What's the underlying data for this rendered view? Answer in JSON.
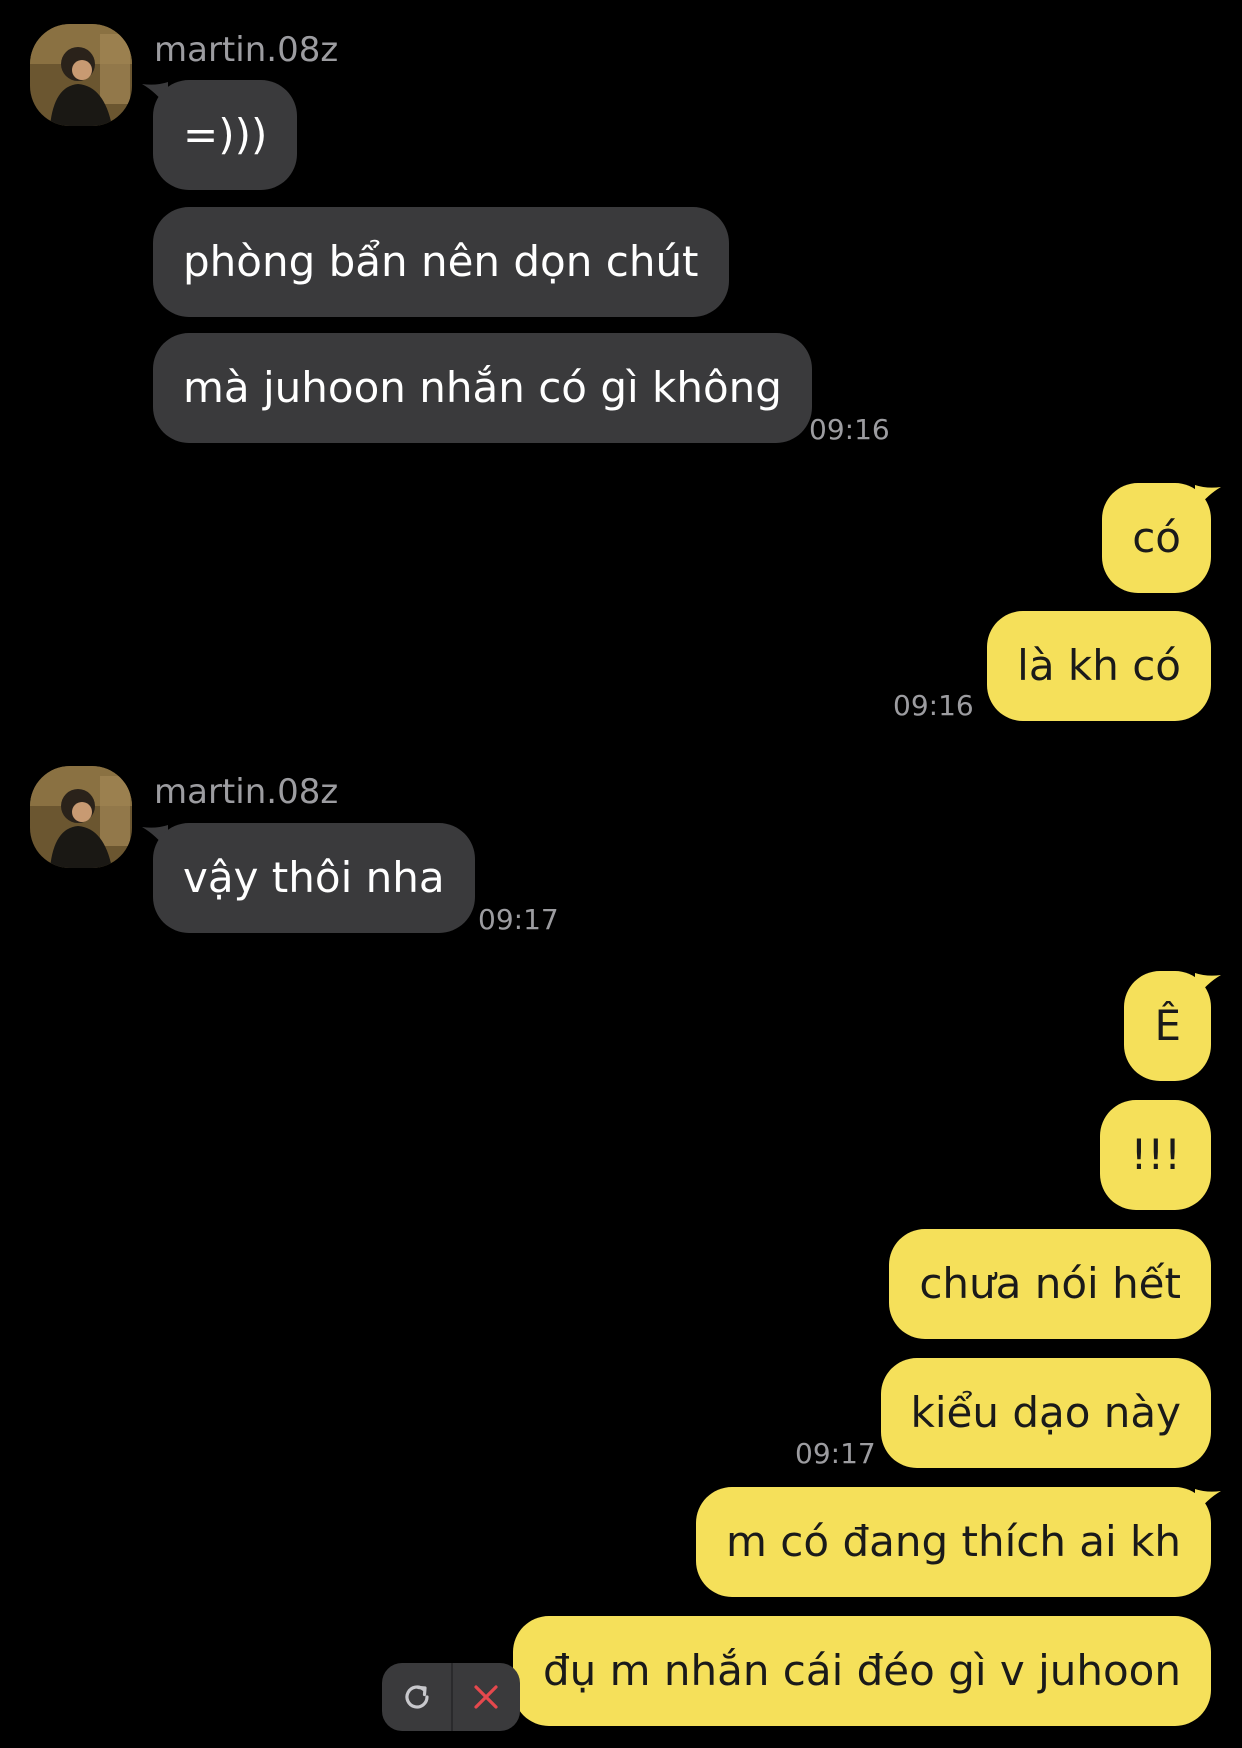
{
  "colors": {
    "background": "#000000",
    "incoming_bubble": "#3a3a3c",
    "outgoing_bubble": "#f5e05a",
    "meta_text": "#9c9ca0",
    "cancel_icon": "#e5484d"
  },
  "groups": [
    {
      "sender": "martin.08z",
      "messages": [
        "=)))",
        "phòng bẩn nên dọn chút",
        "mà juhoon nhắn có gì không"
      ],
      "time": "09:16"
    },
    {
      "messages": [
        "có",
        "là kh có"
      ],
      "time": "09:16"
    },
    {
      "sender": "martin.08z",
      "messages": [
        "vậy thôi nha"
      ],
      "time": "09:17"
    },
    {
      "messages": [
        "Ê",
        "!!!",
        "chưa nói hết",
        "kiểu dạo này",
        "m có đang thích ai kh",
        "đụ m nhắn cái đéo gì v juhoon"
      ],
      "time": "09:17"
    }
  ],
  "failed_message_actions": {
    "retry_icon": "refresh-icon",
    "cancel_icon": "close-icon"
  }
}
